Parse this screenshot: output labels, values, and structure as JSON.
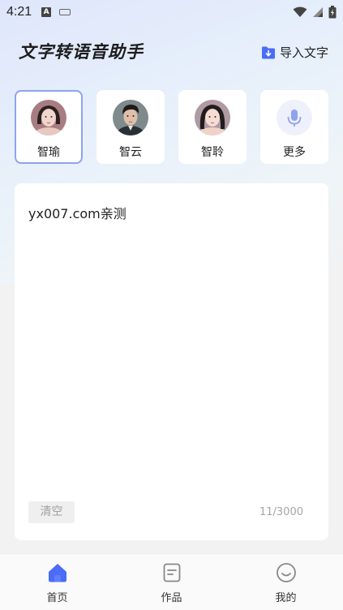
{
  "status_bar": {
    "time": "4:21",
    "icons": [
      "text-a-icon",
      "keyboard-icon",
      "wifi-icon",
      "signal-icon",
      "battery-icon"
    ]
  },
  "header": {
    "title": "文字转语音助手",
    "import_label": "导入文字",
    "import_icon": "import-folder-icon"
  },
  "voices": [
    {
      "name": "智瑜",
      "selected": true
    },
    {
      "name": "智云",
      "selected": false
    },
    {
      "name": "智聆",
      "selected": false
    },
    {
      "name": "更多",
      "selected": false,
      "icon": "microphone-icon"
    }
  ],
  "editor": {
    "text": "yx007.com亲测",
    "clear_label": "清空",
    "char_count": "11/3000"
  },
  "bottom_nav": [
    {
      "label": "首页",
      "icon": "home-icon",
      "active": true
    },
    {
      "label": "作品",
      "icon": "works-icon",
      "active": false
    },
    {
      "label": "我的",
      "icon": "smile-icon",
      "active": false
    }
  ],
  "colors": {
    "accent": "#4a6cf7",
    "selected_border": "#8ea3ef"
  }
}
